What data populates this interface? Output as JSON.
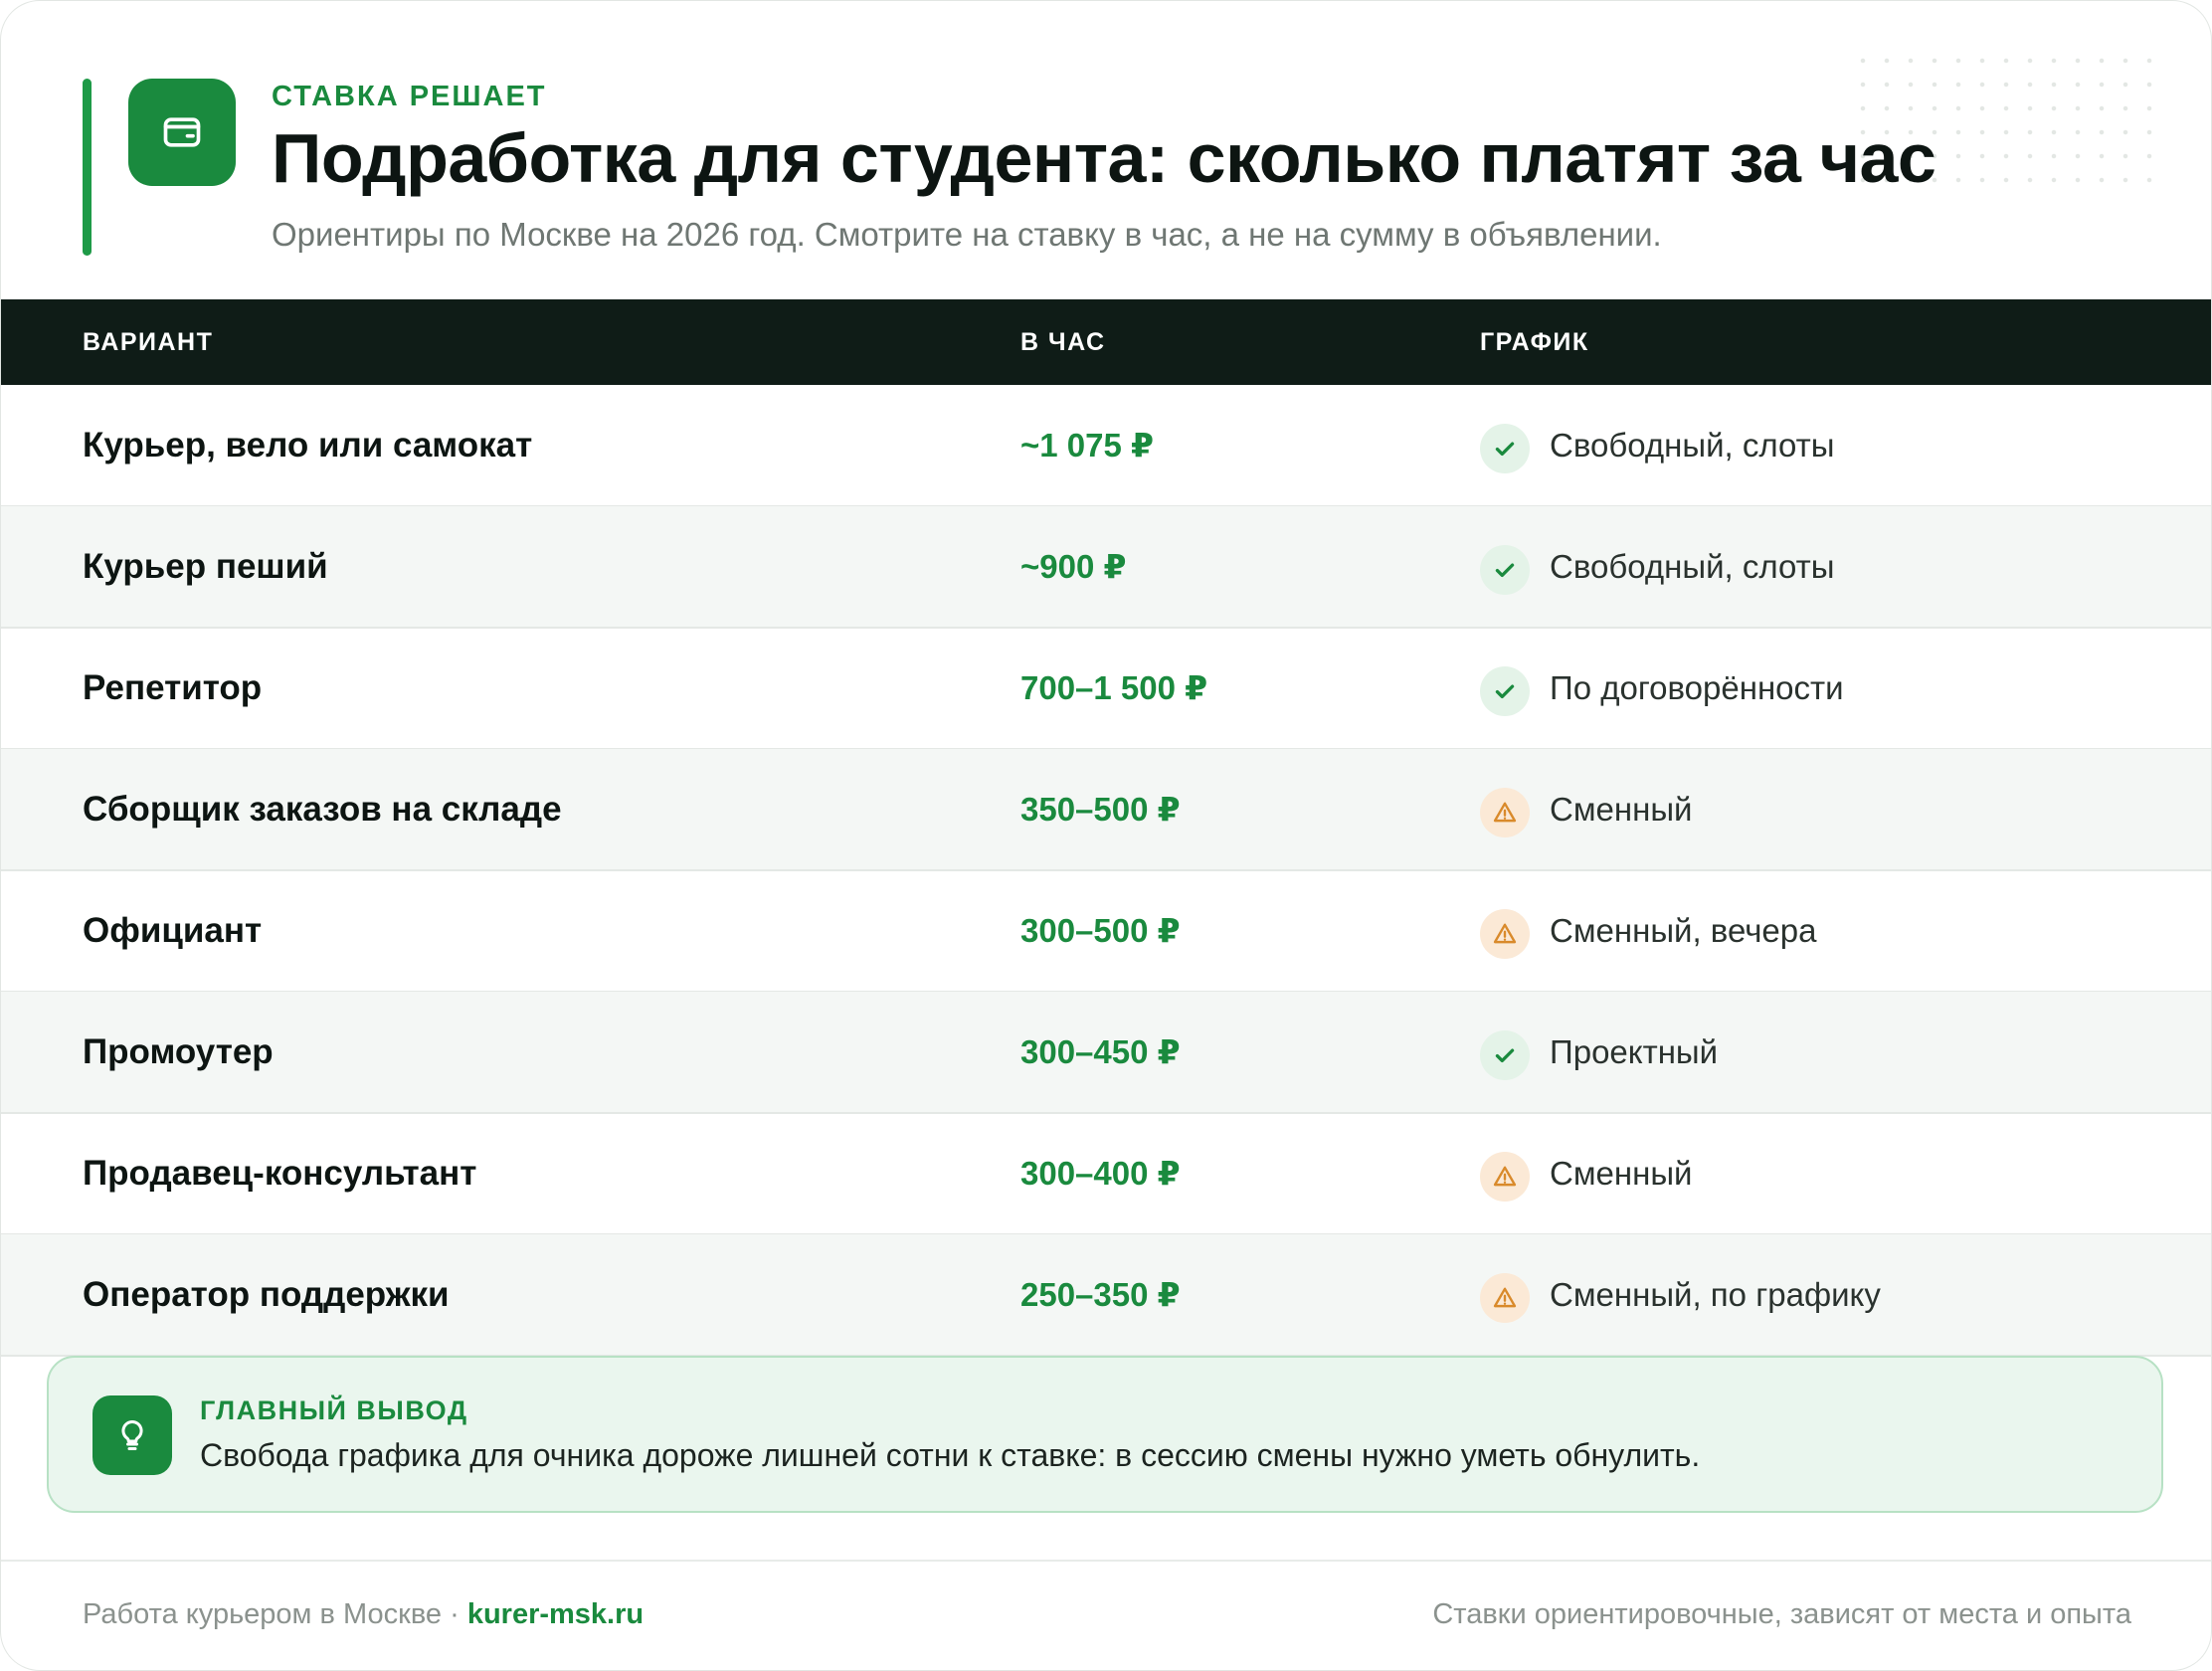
{
  "header": {
    "eyebrow": "СТАВКА РЕШАЕТ",
    "title": "Подработка для студента: сколько платят за час",
    "subtitle": "Ориентиры по Москве на 2026 год. Смотрите на ставку в час, а не на сумму в объявлении.",
    "logo_icon": "wallet-icon"
  },
  "table": {
    "columns": [
      "ВАРИАНТ",
      "В ЧАС",
      "ГРАФИК"
    ],
    "rows": [
      {
        "name": "Курьер, вело или самокат",
        "rate": "~1 075 ₽",
        "status": "ok",
        "schedule": "Свободный, слоты"
      },
      {
        "name": "Курьер пеший",
        "rate": "~900 ₽",
        "status": "ok",
        "schedule": "Свободный, слоты"
      },
      {
        "name": "Репетитор",
        "rate": "700–1 500 ₽",
        "status": "ok",
        "schedule": "По договорённости"
      },
      {
        "name": "Сборщик заказов на складе",
        "rate": "350–500 ₽",
        "status": "warn",
        "schedule": "Сменный"
      },
      {
        "name": "Официант",
        "rate": "300–500 ₽",
        "status": "warn",
        "schedule": "Сменный, вечера"
      },
      {
        "name": "Промоутер",
        "rate": "300–450 ₽",
        "status": "ok",
        "schedule": "Проектный"
      },
      {
        "name": "Продавец-консультант",
        "rate": "300–400 ₽",
        "status": "warn",
        "schedule": "Сменный"
      },
      {
        "name": "Оператор поддержки",
        "rate": "250–350 ₽",
        "status": "warn",
        "schedule": "Сменный, по графику"
      }
    ]
  },
  "callout": {
    "title": "ГЛАВНЫЙ ВЫВОД",
    "text": "Свобода графика для очника дороже лишней сотни к ставке: в сессию смены нужно уметь обнулить.",
    "icon": "lightbulb-icon"
  },
  "footer": {
    "left_text": "Работа курьером в Москве · ",
    "link": "kurer-msk.ru",
    "right_text": "Ставки ориентировочные, зависят от места и опыта"
  },
  "colors": {
    "accent": "#1a8a3e",
    "header_bg": "#0f1c17",
    "ok_badge": "#e4f3e8",
    "warn_badge": "#fbe9d6",
    "warn_icon": "#d98a2b"
  }
}
